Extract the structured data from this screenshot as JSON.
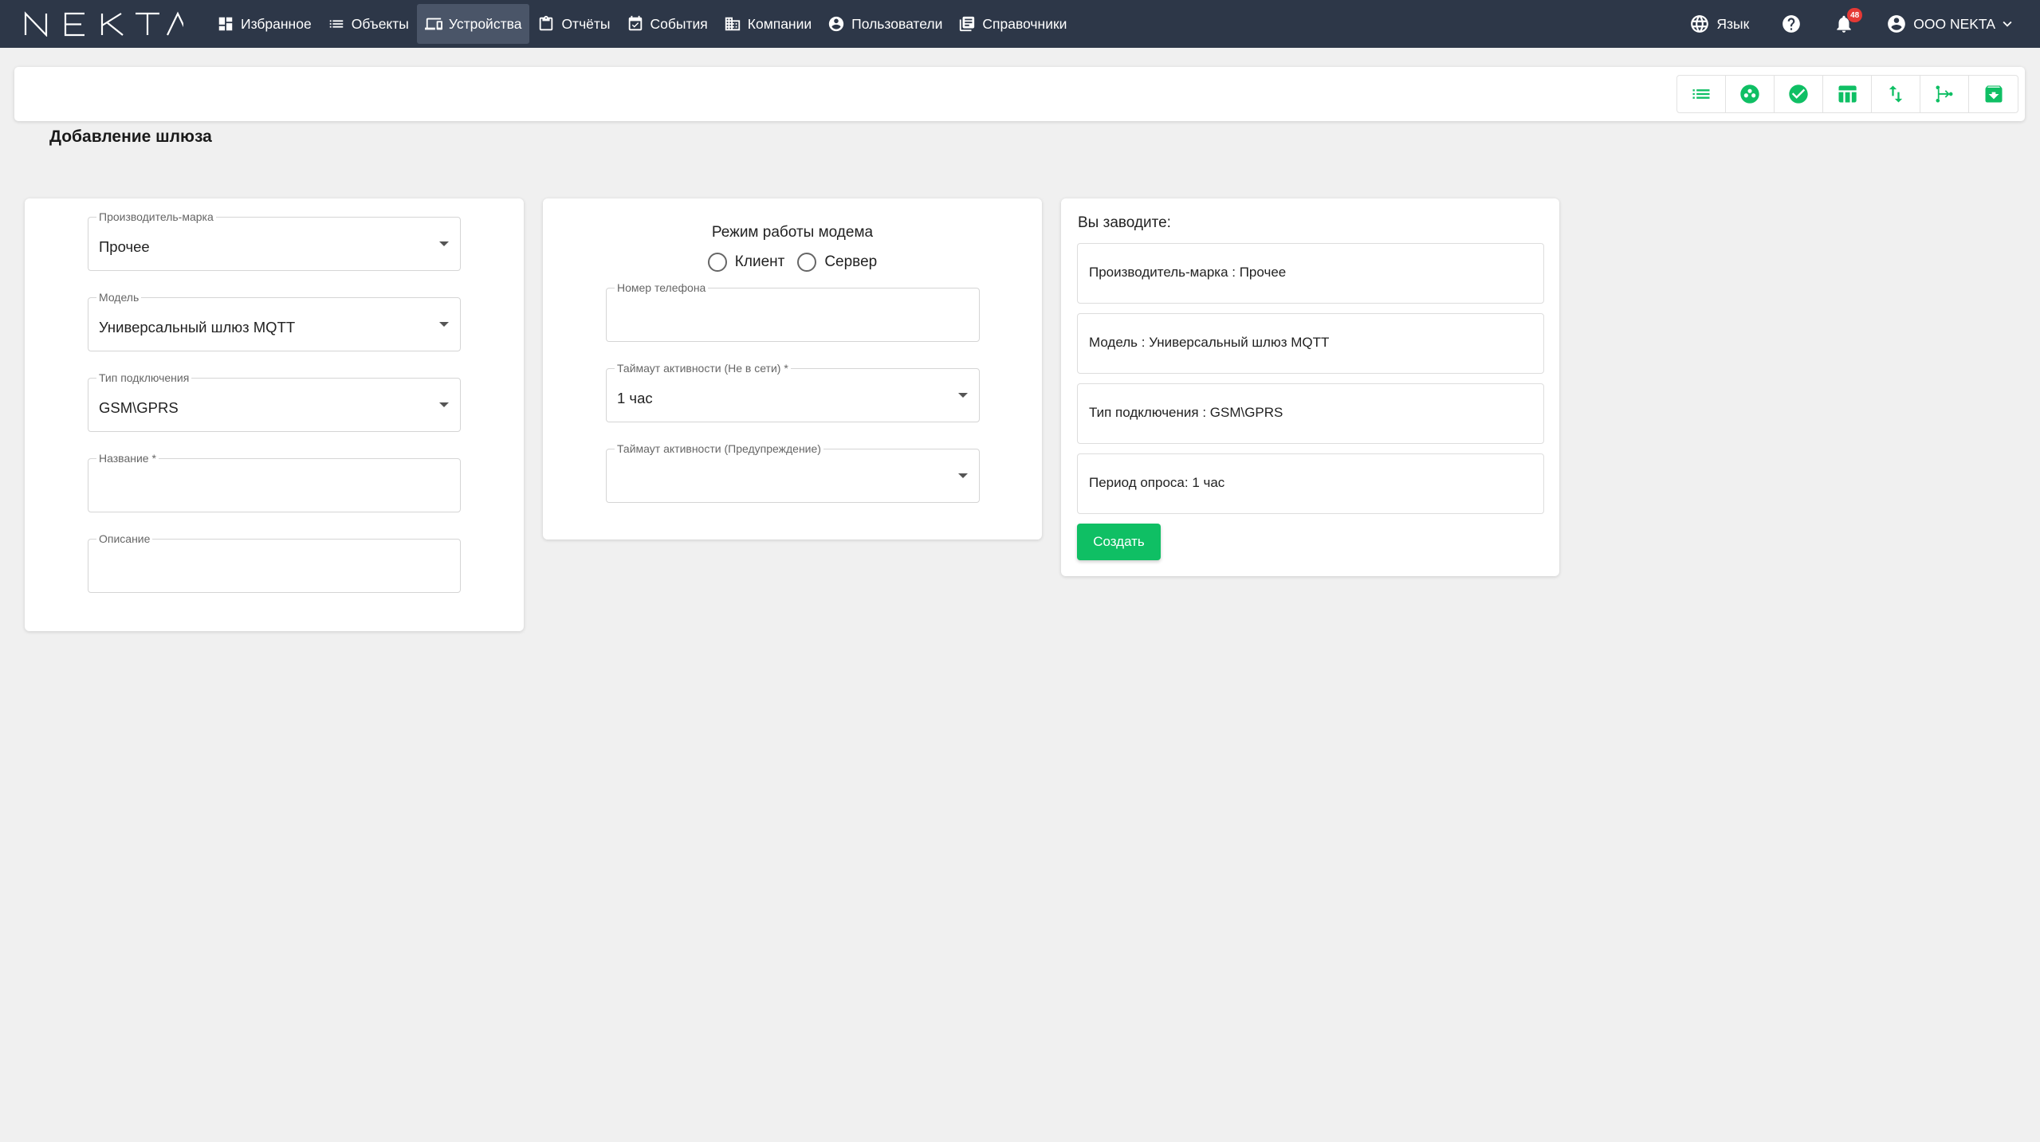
{
  "brand": {
    "logo_text": "NEKTA"
  },
  "nav": {
    "items": [
      {
        "label": "Избранное",
        "icon": "dashboard-icon"
      },
      {
        "label": "Объекты",
        "icon": "list-icon"
      },
      {
        "label": "Устройства",
        "icon": "devices-icon",
        "active": true
      },
      {
        "label": "Отчёты",
        "icon": "clipboard-icon"
      },
      {
        "label": "События",
        "icon": "calendar-check-icon"
      },
      {
        "label": "Компании",
        "icon": "building-icon"
      },
      {
        "label": "Пользователи",
        "icon": "user-circle-icon"
      },
      {
        "label": "Справочники",
        "icon": "books-icon"
      }
    ]
  },
  "right_nav": {
    "language_label": "Язык",
    "notifications_count": "48",
    "account_label": "ООО NEKTA"
  },
  "toolbar": {
    "buttons": [
      "list-icon",
      "group-icon",
      "check-circle-icon",
      "table-icon",
      "swap-vertical-icon",
      "branch-icon",
      "archive-icon"
    ]
  },
  "page": {
    "title": "Добавление шлюза"
  },
  "form_left": {
    "manufacturer": {
      "label": "Производитель-марка",
      "value": "Прочее"
    },
    "model": {
      "label": "Модель",
      "value": "Универсальный шлюз MQTT"
    },
    "connection_type": {
      "label": "Тип подключения",
      "value": "GSM\\GPRS"
    },
    "name": {
      "label": "Название *",
      "value": ""
    },
    "description": {
      "label": "Описание",
      "value": ""
    }
  },
  "form_middle": {
    "modem_mode_title": "Режим работы модема",
    "radio_client": "Клиент",
    "radio_server": "Сервер",
    "phone": {
      "label": "Номер телефона",
      "value": ""
    },
    "timeout_offline": {
      "label": "Таймаут активности (Не в сети) *",
      "value": "1 час"
    },
    "timeout_warning": {
      "label": "Таймаут активности (Предупреждение)",
      "value": ""
    }
  },
  "summary": {
    "title": "Вы заводите:",
    "lines": [
      "Производитель-марка : Прочее",
      "Модель : Универсальный шлюз MQTT",
      "Тип подключения : GSM\\GPRS",
      "Период опроса: 1 час"
    ],
    "create_label": "Создать"
  },
  "colors": {
    "topbar": "#2d3748",
    "accent": "#0fbf64",
    "badge": "#e53935"
  }
}
